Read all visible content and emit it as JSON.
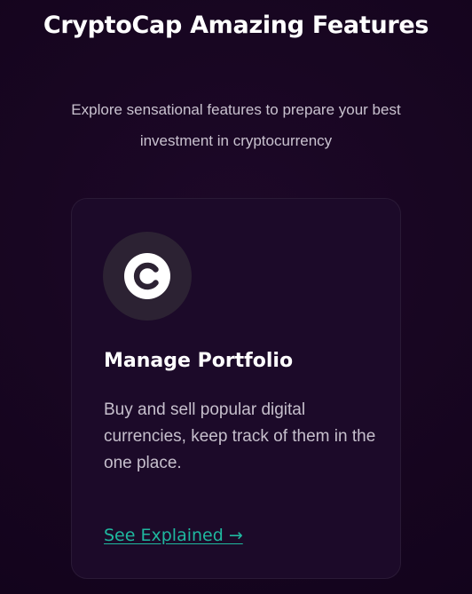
{
  "header": {
    "title": "CryptoCap Amazing Features",
    "subtitle": "Explore sensational features to prepare your best investment in cryptocurrency"
  },
  "feature_card": {
    "icon": "coin-c-icon",
    "title": "Manage Portfolio",
    "description": "Buy and sell popular digital currencies, keep track of them in the one place.",
    "link_label": "See Explained →"
  },
  "colors": {
    "background": "#16051f",
    "card": "#1c0a29",
    "accent": "#1fb89f",
    "icon_bg": "#2c2233"
  }
}
